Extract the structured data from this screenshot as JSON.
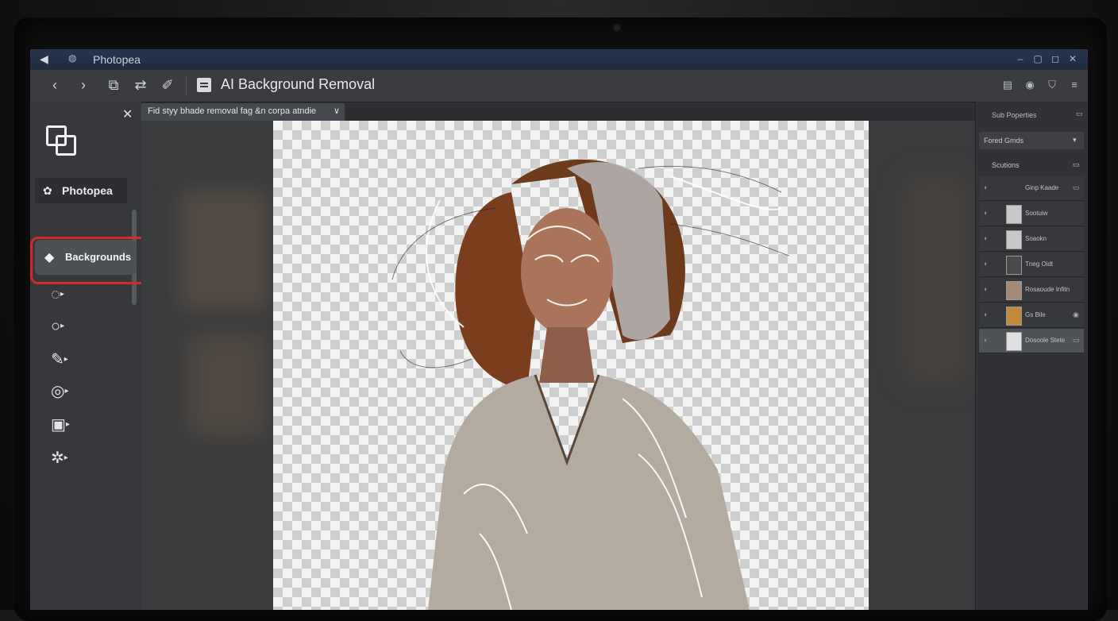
{
  "window": {
    "app_name": "Photopea",
    "controls": [
      "–",
      "▢",
      "◻",
      "✕"
    ]
  },
  "toolbar": {
    "back": "‹",
    "forward": "›",
    "tool_title": "AI Background Removal"
  },
  "left_panel": {
    "close": "✕",
    "brand_label": "Photopea",
    "selected_item_label": "Backgrounds",
    "tools": [
      {
        "name": "lasso-icon",
        "glyph": "◌"
      },
      {
        "name": "ellipse-select-icon",
        "glyph": "○"
      },
      {
        "name": "brush-icon",
        "glyph": "✎"
      },
      {
        "name": "circle-tool-icon",
        "glyph": "◎"
      },
      {
        "name": "camera-icon",
        "glyph": "▣"
      },
      {
        "name": "settings-icon",
        "glyph": "✲"
      }
    ]
  },
  "document_tab": {
    "label": "Fid styy bhade removal fag &n corpa atndie",
    "dropdown": "∨"
  },
  "right_panel": {
    "header": "Sub Poperties",
    "dropdown": "Fored Gmds",
    "layers_header": "Scutions",
    "layers": [
      {
        "label": "Ginp Kaade",
        "active": false
      },
      {
        "label": "Sootuiw",
        "active": false
      },
      {
        "label": "Soaokn",
        "active": false
      },
      {
        "label": "Tneg Oidt",
        "active": false
      },
      {
        "label": "Rosaoude Infitn",
        "active": false
      },
      {
        "label": "Gs Bile",
        "active": false
      },
      {
        "label": "Dosoole Stete",
        "active": true
      }
    ]
  }
}
